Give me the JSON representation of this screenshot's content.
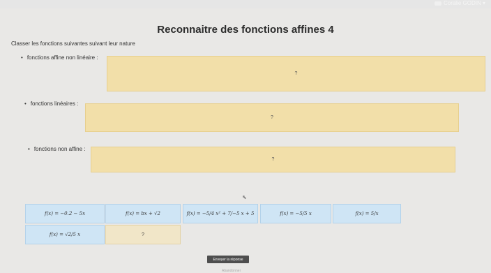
{
  "header": {
    "user_name": "Coralie GODIN ▾"
  },
  "page": {
    "title": "Reconnaitre des fonctions affines 4",
    "instructions": "Classer les fonctions suivantes suivant leur nature"
  },
  "categories": [
    {
      "label": "fonctions affine non linéaire :",
      "placeholder": "?"
    },
    {
      "label": "fonctions linéaires :",
      "placeholder": "?"
    },
    {
      "label": "fonctions non affine :",
      "placeholder": "?"
    }
  ],
  "tiles": [
    {
      "text": "f(x) = −0.2 − 5x"
    },
    {
      "text": "f(x) = bx + √2"
    },
    {
      "text": "f(x) = −5/4 x² + 7/−5 x + 5"
    },
    {
      "text": "f(x) = −5/5 x"
    },
    {
      "text": "f(x) = 5/x"
    },
    {
      "text": "f(x) = √2/5 x"
    },
    {
      "text": "?"
    }
  ],
  "actions": {
    "submit_label": "Envoyer la réponse"
  },
  "footer": {
    "text": "Abandonner"
  }
}
